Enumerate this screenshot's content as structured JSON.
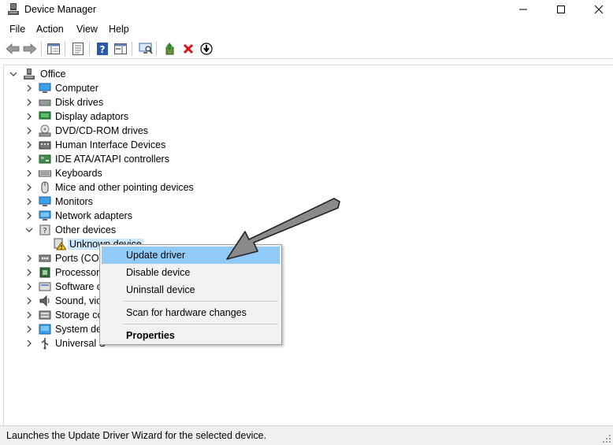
{
  "window": {
    "title": "Device Manager"
  },
  "menu": [
    "File",
    "Action",
    "View",
    "Help"
  ],
  "tree": {
    "root": "Office",
    "categories": [
      {
        "label": "Computer",
        "icon": "computer-icon"
      },
      {
        "label": "Disk drives",
        "icon": "disk-drive-icon"
      },
      {
        "label": "Display adaptors",
        "icon": "display-adapter-icon"
      },
      {
        "label": "DVD/CD-ROM drives",
        "icon": "dvd-drive-icon"
      },
      {
        "label": "Human Interface Devices",
        "icon": "hid-icon"
      },
      {
        "label": "IDE ATA/ATAPI controllers",
        "icon": "ide-controller-icon"
      },
      {
        "label": "Keyboards",
        "icon": "keyboard-icon"
      },
      {
        "label": "Mice and other pointing devices",
        "icon": "mouse-icon"
      },
      {
        "label": "Monitors",
        "icon": "monitor-icon"
      },
      {
        "label": "Network adapters",
        "icon": "network-adapter-icon"
      },
      {
        "label": "Other devices",
        "icon": "other-devices-icon"
      },
      {
        "label": "Unknown device",
        "icon": "unknown-device-warning-icon"
      },
      {
        "label": "Ports (COM",
        "icon": "ports-icon"
      },
      {
        "label": "Processors",
        "icon": "processor-icon"
      },
      {
        "label": "Software c",
        "icon": "software-component-icon"
      },
      {
        "label": "Sound, vic",
        "icon": "sound-icon"
      },
      {
        "label": "Storage co",
        "icon": "storage-controller-icon"
      },
      {
        "label": "System de",
        "icon": "system-device-icon"
      },
      {
        "label": "Universal S",
        "icon": "usb-controller-icon"
      }
    ]
  },
  "context_menu": {
    "update": "Update driver",
    "disable": "Disable device",
    "uninstall": "Uninstall device",
    "scan": "Scan for hardware changes",
    "properties": "Properties"
  },
  "status": {
    "text": "Launches the Update Driver Wizard for the selected device."
  },
  "colors": {
    "selection": "#cce8ff",
    "menu_hover": "#91c9f7",
    "arrow": "#8a8a8a"
  }
}
